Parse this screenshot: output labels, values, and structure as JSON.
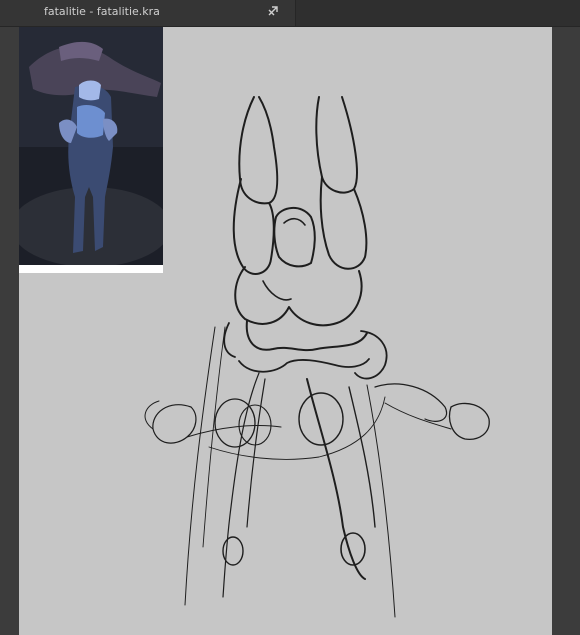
{
  "tab": {
    "title": "fatalitie - fatalitie.kra",
    "close_icon": "close-icon"
  },
  "colors": {
    "topbar_bg": "#2f2f2f",
    "canvas_bg": "#c6c6c6",
    "workspace_bg": "#3c3c3c",
    "sketch_stroke": "#1f1f1f"
  },
  "reference": {
    "icon": "figure-photo"
  }
}
